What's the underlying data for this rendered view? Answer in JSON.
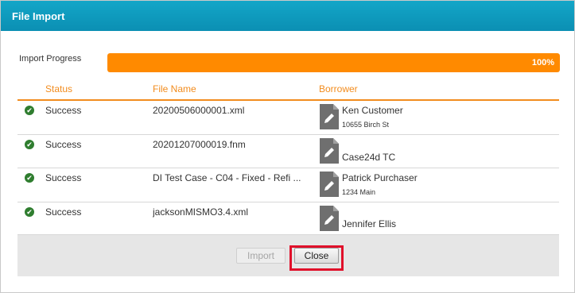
{
  "dialog": {
    "title": "File Import"
  },
  "progress": {
    "label": "Import Progress",
    "percent": 100,
    "text": "100%"
  },
  "table": {
    "columns": {
      "status": "Status",
      "file_name": "File Name",
      "borrower": "Borrower"
    },
    "rows": [
      {
        "status": "Success",
        "file": "20200506000001.xml",
        "borrower": "Ken Customer",
        "address": "10655 Birch St"
      },
      {
        "status": "Success",
        "file": "20201207000019.fnm",
        "borrower": "Case24d TC",
        "address": ""
      },
      {
        "status": "Success",
        "file": "DI Test Case - C04 - Fixed - Refi ...",
        "borrower": "Patrick Purchaser",
        "address": "1234 Main"
      },
      {
        "status": "Success",
        "file": "jacksonMISMO3.4.xml",
        "borrower": "Jennifer Ellis",
        "address": ""
      }
    ]
  },
  "footer": {
    "import_label": "Import",
    "close_label": "Close"
  },
  "colors": {
    "title_bar": "#0b9dc1",
    "progress": "#ff8a00",
    "header": "#f28c1e",
    "success": "#2f7d2f",
    "highlight": "#e0102a"
  }
}
